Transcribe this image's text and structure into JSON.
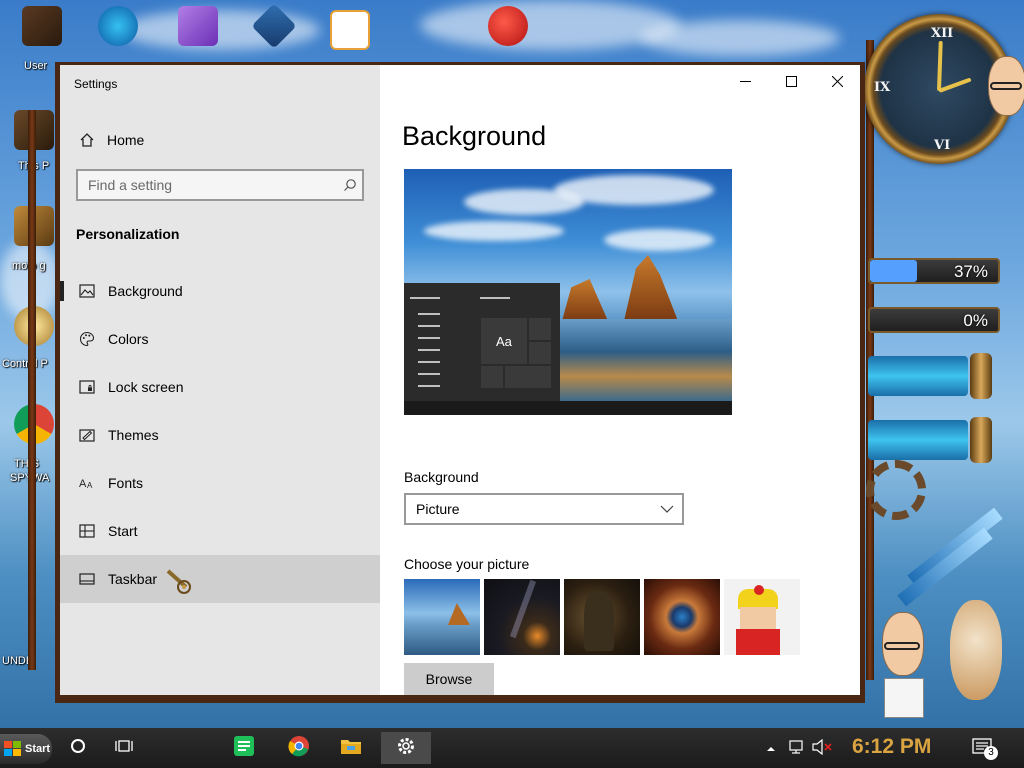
{
  "desktop": {
    "icon_labels": [
      "User",
      "This P",
      "moto g",
      "Control P",
      "THIS",
      "SPYWA",
      "UNDE"
    ],
    "gauges": [
      {
        "label": "37%",
        "fill_fraction": 0.37,
        "color": "#55a0ff"
      },
      {
        "label": "0%",
        "fill_fraction": 0.0,
        "color": "#4cc24c"
      }
    ]
  },
  "window": {
    "app_title": "Settings",
    "controls": {
      "minimize": "—",
      "maximize": "☐",
      "close": "✕"
    }
  },
  "sidebar": {
    "home_label": "Home",
    "search_placeholder": "Find a setting",
    "section_label": "Personalization",
    "items": [
      {
        "label": "Background",
        "icon": "picture-icon"
      },
      {
        "label": "Colors",
        "icon": "palette-icon"
      },
      {
        "label": "Lock screen",
        "icon": "lock-screen-icon"
      },
      {
        "label": "Themes",
        "icon": "themes-icon"
      },
      {
        "label": "Fonts",
        "icon": "fonts-icon"
      },
      {
        "label": "Start",
        "icon": "start-icon"
      },
      {
        "label": "Taskbar",
        "icon": "taskbar-icon"
      }
    ]
  },
  "main": {
    "title": "Background",
    "preview_sample_text": "Aa",
    "background_label": "Background",
    "background_value": "Picture",
    "choose_label": "Choose your picture",
    "browse_label": "Browse"
  },
  "taskbar": {
    "start_label": "Start",
    "time": "6:12 PM",
    "notification_count": "3"
  },
  "colors": {
    "sidebar_bg": "#e6e6e6",
    "frame": "#4a2712",
    "clock_accent": "#d9a441"
  }
}
